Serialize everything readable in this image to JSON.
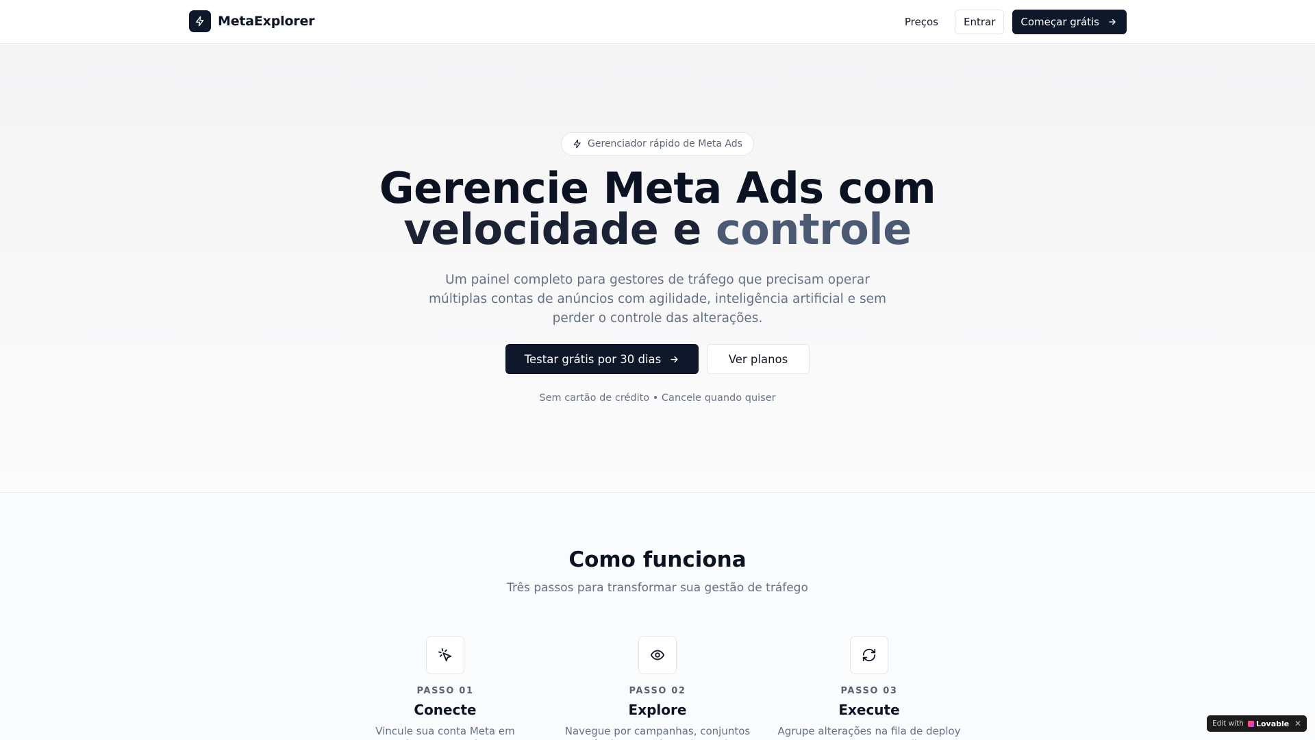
{
  "header": {
    "brand_name": "MetaExplorer",
    "nav_prices": "Preços",
    "login_label": "Entrar",
    "start_label": "Começar grátis"
  },
  "hero": {
    "badge": "Gerenciador rápido de Meta Ads",
    "title_line1": "Gerencie Meta Ads com",
    "title_line2_a": "velocidade e",
    "title_line2_b": "controle",
    "subtitle": "Um painel completo para gestores de tráfego que precisam operar múltiplas contas de anúncios com agilidade, inteligência artificial e sem perder o controle das alterações.",
    "cta_primary": "Testar grátis por 30 dias",
    "cta_secondary": "Ver planos",
    "note": "Sem cartão de crédito • Cancele quando quiser"
  },
  "how": {
    "title": "Como funciona",
    "subtitle": "Três passos para transformar sua gestão de tráfego",
    "steps": [
      {
        "num": "PASSO 01",
        "title": "Conecte",
        "desc": "Vincule sua conta Meta em segundos com OAuth seguro",
        "icon": "pointer-click-icon"
      },
      {
        "num": "PASSO 02",
        "title": "Explore",
        "desc": "Navegue por campanhas, conjuntos e anúncios em colunas interativas",
        "icon": "eye-icon"
      },
      {
        "num": "PASSO 03",
        "title": "Execute",
        "desc": "Agrupe alterações na fila de deploy e processe com um clique",
        "icon": "refresh-icon"
      }
    ]
  },
  "lovable": {
    "edit_with": "Edit with",
    "brand": "Lovable",
    "close": "✕"
  },
  "colors": {
    "primary_dark": "#0f172a",
    "accent_slate": "#4b5a72",
    "muted_text": "#667085"
  }
}
